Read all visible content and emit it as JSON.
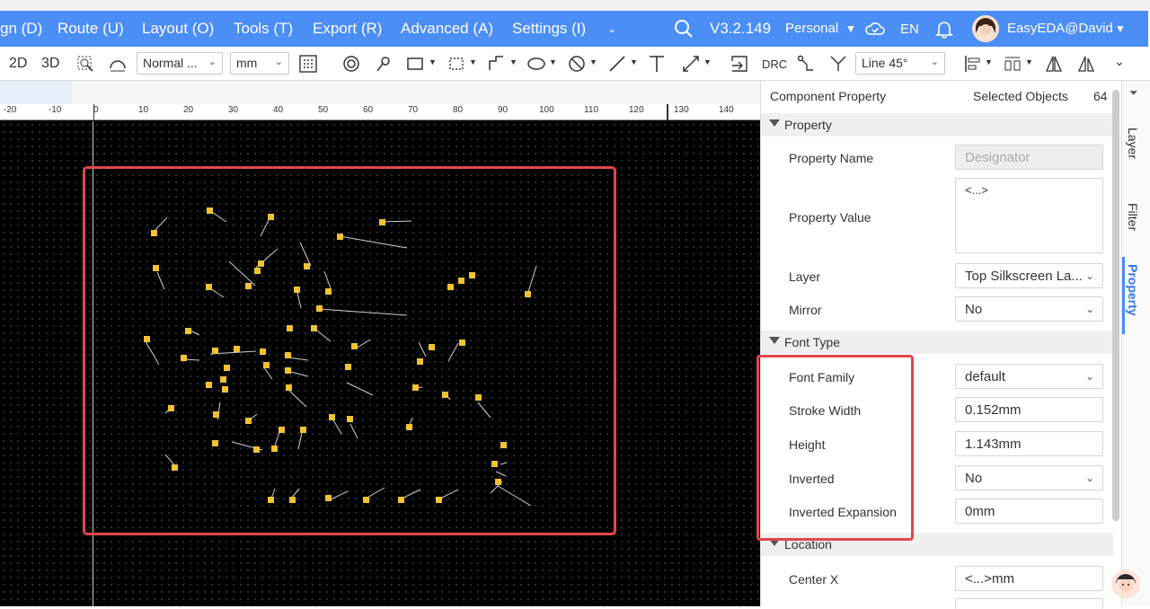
{
  "menu": {
    "items": [
      "gn (D)",
      "Route (U)",
      "Layout (O)",
      "Tools (T)",
      "Export (R)",
      "Advanced (A)",
      "Settings (I)"
    ],
    "version": "V3.2.149",
    "workspace": "Personal",
    "language": "EN",
    "user": "EasyEDA@David"
  },
  "toolbar": {
    "view_2d": "2D",
    "view_3d": "3D",
    "layer_mode": "Normal ...",
    "unit": "mm",
    "drc_label": "DRC",
    "route_angle": "Line 45°"
  },
  "ruler": {
    "ticks": [
      "-20",
      "-10",
      "0",
      "10",
      "20",
      "30",
      "40",
      "50",
      "60",
      "70",
      "80",
      "90",
      "100",
      "110",
      "120",
      "130",
      "140"
    ]
  },
  "panel": {
    "title": "Component Property",
    "selected_label": "Selected Objects",
    "selected_count": "64",
    "sections": {
      "property": "Property",
      "font_type": "Font Type",
      "location": "Location"
    },
    "fields": {
      "property_name_label": "Property Name",
      "property_name_value": "Designator",
      "property_value_label": "Property Value",
      "property_value_value": "<...>",
      "layer_label": "Layer",
      "layer_value": "Top Silkscreen La...",
      "mirror_label": "Mirror",
      "mirror_value": "No",
      "font_family_label": "Font Family",
      "font_family_value": "default",
      "stroke_width_label": "Stroke Width",
      "stroke_width_value": "0.152mm",
      "height_label": "Height",
      "height_value": "1.143mm",
      "inverted_label": "Inverted",
      "inverted_value": "No",
      "inverted_expansion_label": "Inverted Expansion",
      "inverted_expansion_value": "0mm",
      "center_x_label": "Center X",
      "center_x_value": "<...>mm"
    }
  },
  "side_tabs": [
    "Layer",
    "Filter",
    "Property"
  ],
  "colors": {
    "menubar": "#4b8ef6",
    "highlight": "#e0474c",
    "component": "#f2c230",
    "canvas": "#000000"
  }
}
